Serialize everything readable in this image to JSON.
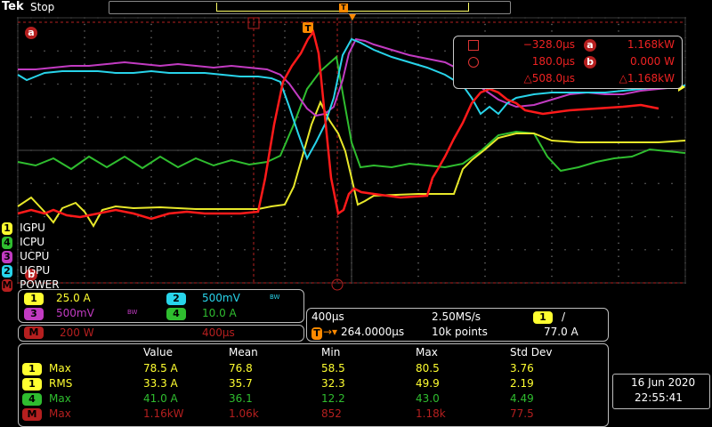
{
  "header": {
    "brand": "Tek",
    "run_state": "Stop",
    "trigger_marker": "T"
  },
  "colors": {
    "ch1": "#ffff30",
    "ch2": "#28d4ea",
    "ch3": "#c23bc2",
    "ch4": "#2fbd2f",
    "math": "#ff1a1a",
    "cursor": "#b51f1f",
    "grid": "#555555"
  },
  "channels": [
    {
      "id": "1",
      "label": "IGPU",
      "color": "#ffff30"
    },
    {
      "id": "4",
      "label": "ICPU",
      "color": "#2fbd2f"
    },
    {
      "id": "3",
      "label": "UCPU",
      "color": "#c23bc2"
    },
    {
      "id": "2",
      "label": "UGPU",
      "color": "#28d4ea"
    },
    {
      "id": "M",
      "label": "POWER",
      "color": "#b51f1f"
    }
  ],
  "cursor_a_label": "a",
  "cursor_b_label": "b",
  "cursor_readout": {
    "a_time": "−328.0µs",
    "a_value": "1.168kW",
    "b_time": "180.0µs",
    "b_value": "0.000 W",
    "delta_time": "△508.0µs",
    "delta_value": "△1.168kW"
  },
  "vertical_settings": {
    "ch1": {
      "num": "1",
      "scale": "25.0 A"
    },
    "ch2": {
      "num": "2",
      "scale": "500mV",
      "bw": "BW"
    },
    "ch3": {
      "num": "3",
      "scale": "500mV",
      "bw": "BW"
    },
    "ch4": {
      "num": "4",
      "scale": "10.0 A"
    },
    "math": {
      "num": "M",
      "scale": "200 W",
      "time": "400µs"
    }
  },
  "horizontal": {
    "time_div": "400µs",
    "sample_rate": "2.50MS/s",
    "trigger_pos": "264.0000µs",
    "record": "10k points",
    "trigger_source": "1",
    "trigger_slope": "/",
    "trigger_level": "77.0 A"
  },
  "measurements": {
    "headers": [
      "Value",
      "Mean",
      "Min",
      "Max",
      "Std Dev"
    ],
    "rows": [
      {
        "src": "1",
        "name": "Max",
        "color": "#ffff30",
        "vals": [
          "78.5 A",
          "76.8",
          "58.5",
          "80.5",
          "3.76"
        ]
      },
      {
        "src": "1",
        "name": "RMS",
        "color": "#ffff30",
        "vals": [
          "33.3 A",
          "35.7",
          "32.3",
          "49.9",
          "2.19"
        ]
      },
      {
        "src": "4",
        "name": "Max",
        "color": "#2fbd2f",
        "vals": [
          "41.0 A",
          "36.1",
          "12.2",
          "43.0",
          "4.49"
        ]
      },
      {
        "src": "M",
        "name": "Max",
        "color": "#b51f1f",
        "vals": [
          "1.16kW",
          "1.06k",
          "852",
          "1.18k",
          "77.5"
        ]
      }
    ]
  },
  "datetime": {
    "date": "16 Jun  2020",
    "time": "22:55:41"
  }
}
